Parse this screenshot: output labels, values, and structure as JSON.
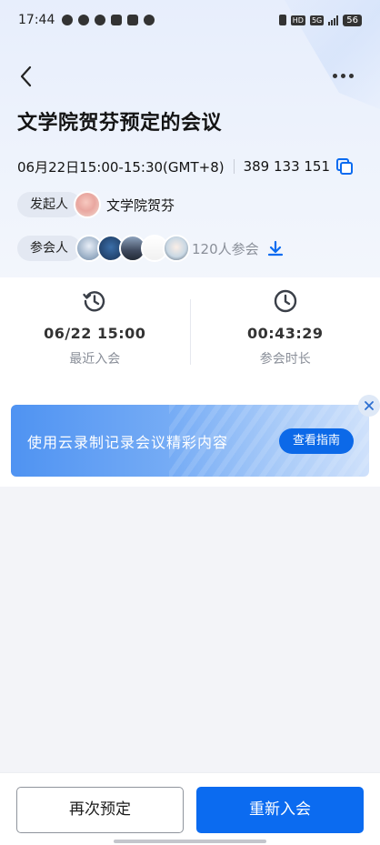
{
  "status_bar": {
    "time": "17:44",
    "network_tag": "HD",
    "signal_tag": "5G",
    "battery": "56"
  },
  "header": {
    "back_icon": "chevron-left-icon",
    "more_icon": "more-horizontal-icon"
  },
  "meeting": {
    "title": "文学院贺芬预定的会议",
    "time_range": "06月22日15:00-15:30(GMT+8)",
    "meeting_id": "389 133 151",
    "host_label": "发起人",
    "host_name": "文学院贺芬",
    "participants_label": "参会人",
    "participants_count": "120人参会"
  },
  "stats": {
    "last_join_value": "06/22 15:00",
    "last_join_label": "最近入会",
    "duration_value": "00:43:29",
    "duration_label": "参会时长"
  },
  "banner": {
    "text": "使用云录制记录会议精彩内容",
    "button": "查看指南"
  },
  "actions": {
    "reschedule": "再次预定",
    "rejoin": "重新入会"
  },
  "colors": {
    "accent": "#0b6bf0",
    "banner_button": "#0c69e8"
  }
}
